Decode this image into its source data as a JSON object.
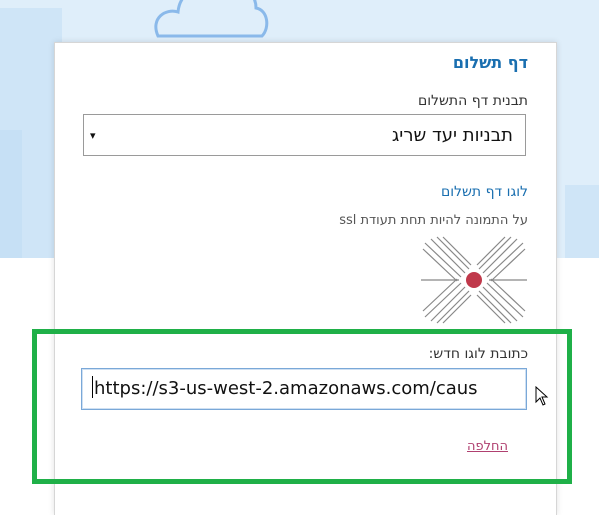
{
  "panel": {
    "title": "דף תשלום",
    "template_label": "תבנית דף התשלום",
    "template_select": {
      "value": "תבניות יעד שריג",
      "arrow": "▾"
    },
    "logo_label": "לוגו דף תשלום",
    "logo_hint": "על התמונה להיות תחת תעודת ssl",
    "new_logo_label": "כתובת לוגו חדש:",
    "new_logo_url": "https://s3-us-west-2.amazonaws.com/caus",
    "replace_link": "החלפה"
  },
  "colors": {
    "accent": "#1a6fb0",
    "link": "#b04070",
    "highlight": "#1fb048",
    "logo_dot": "#c0394b"
  }
}
